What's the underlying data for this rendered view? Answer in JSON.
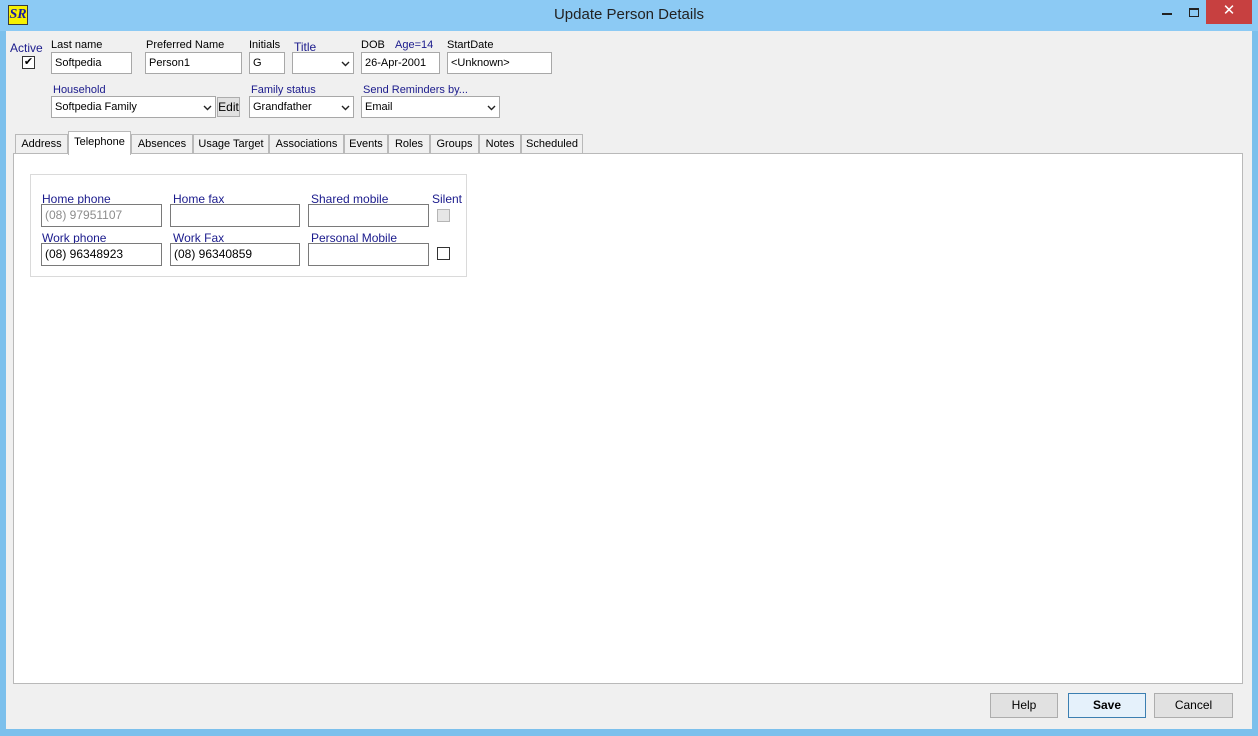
{
  "window": {
    "title": "Update Person Details",
    "icon_text": "SR"
  },
  "header": {
    "active_label": "Active",
    "active_checked": true,
    "last_name_label": "Last name",
    "last_name_value": "Softpedia",
    "preferred_name_label": "Preferred Name",
    "preferred_name_value": "Person1",
    "initials_label": "Initials",
    "initials_value": "G",
    "title_label": "Title",
    "title_value": "",
    "dob_label": "DOB",
    "age_label": "Age=14",
    "dob_value": "26-Apr-2001",
    "start_date_label": "StartDate",
    "start_date_value": "<Unknown>",
    "household_label": "Household",
    "household_value": "Softpedia Family",
    "edit_label": "Edit",
    "family_status_label": "Family status",
    "family_status_value": "Grandfather",
    "reminders_label": "Send Reminders by...",
    "reminders_value": "Email"
  },
  "tabs": [
    {
      "label": "Address",
      "active": false
    },
    {
      "label": "Telephone",
      "active": true
    },
    {
      "label": "Absences",
      "active": false
    },
    {
      "label": "Usage Target",
      "active": false
    },
    {
      "label": "Associations",
      "active": false
    },
    {
      "label": "Events",
      "active": false
    },
    {
      "label": "Roles",
      "active": false
    },
    {
      "label": "Groups",
      "active": false
    },
    {
      "label": "Notes",
      "active": false
    },
    {
      "label": "Scheduled",
      "active": false
    }
  ],
  "telephone": {
    "home_phone_label": "Home phone",
    "home_phone_value": "(08) 97951107",
    "home_fax_label": "Home fax",
    "home_fax_value": "",
    "shared_mobile_label": "Shared mobile",
    "shared_mobile_value": "",
    "silent_label": "Silent",
    "work_phone_label": "Work phone",
    "work_phone_value": "(08) 96348923",
    "work_fax_label": "Work Fax",
    "work_fax_value": "(08) 96340859",
    "personal_mobile_label": "Personal Mobile",
    "personal_mobile_value": ""
  },
  "footer": {
    "help_label": "Help",
    "save_label": "Save",
    "cancel_label": "Cancel"
  }
}
